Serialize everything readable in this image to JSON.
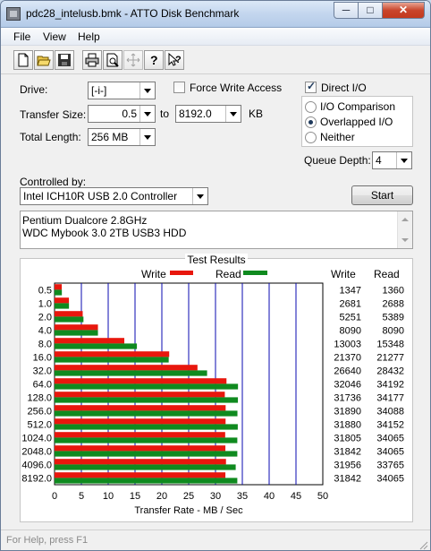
{
  "window": {
    "title": "pdc28_intelusb.bmk - ATTO Disk Benchmark",
    "minimize": "─",
    "maximize": "□",
    "close": "✕"
  },
  "menu": [
    "File",
    "View",
    "Help"
  ],
  "toolbar": {
    "icons": [
      "new-file-icon",
      "open-folder-icon",
      "save-icon",
      "print-icon",
      "print-preview-icon",
      "move-icon",
      "help-icon",
      "context-help-icon"
    ]
  },
  "settings": {
    "drive_label": "Drive:",
    "drive_value": "[-i-]",
    "force_write_label": "Force Write Access",
    "force_write_checked": false,
    "direct_io_label": "Direct I/O",
    "direct_io_checked": true,
    "transfer_size_label": "Transfer Size:",
    "transfer_from": "0.5",
    "to_label": "to",
    "transfer_to": "8192.0",
    "kb_label": "KB",
    "total_length_label": "Total Length:",
    "total_length_value": "256 MB",
    "io_options": [
      {
        "label": "I/O Comparison",
        "selected": false
      },
      {
        "label": "Overlapped I/O",
        "selected": true
      },
      {
        "label": "Neither",
        "selected": false
      }
    ],
    "queue_depth_label": "Queue Depth:",
    "queue_depth_value": "4",
    "controlled_by_label": "Controlled by:",
    "controller_value": "Intel ICH10R USB 2.0 Controller",
    "start_label": "Start"
  },
  "info_lines": [
    "Pentium Dualcore 2.8GHz",
    "WDC Mybook 3.0 2TB USB3 HDD"
  ],
  "results_title": "Test Results",
  "legend": {
    "write": "Write",
    "read": "Read"
  },
  "columns": {
    "write": "Write",
    "read": "Read"
  },
  "colors": {
    "write": "#e8170d",
    "read": "#0f8a1f",
    "grid": "#0a0ab0"
  },
  "chart_data": {
    "type": "bar",
    "orientation": "horizontal",
    "categories": [
      "0.5",
      "1.0",
      "2.0",
      "4.0",
      "8.0",
      "16.0",
      "32.0",
      "64.0",
      "128.0",
      "256.0",
      "512.0",
      "1024.0",
      "2048.0",
      "4096.0",
      "8192.0"
    ],
    "series": [
      {
        "name": "Write",
        "values": [
          1347,
          2681,
          5251,
          8090,
          13003,
          21370,
          26640,
          32046,
          31736,
          31890,
          31880,
          31805,
          31842,
          31956,
          31842
        ]
      },
      {
        "name": "Read",
        "values": [
          1360,
          2688,
          5389,
          8090,
          15348,
          21277,
          28432,
          34192,
          34177,
          34088,
          34152,
          34065,
          34065,
          33765,
          34065
        ]
      }
    ],
    "xlabel": "Transfer Rate - MB / Sec",
    "xticks": [
      "0",
      "5",
      "10",
      "15",
      "20",
      "25",
      "30",
      "35",
      "40",
      "45",
      "50"
    ],
    "xlim": [
      0,
      50
    ],
    "grid": true,
    "legend_position": "top"
  },
  "status": "For Help, press F1"
}
